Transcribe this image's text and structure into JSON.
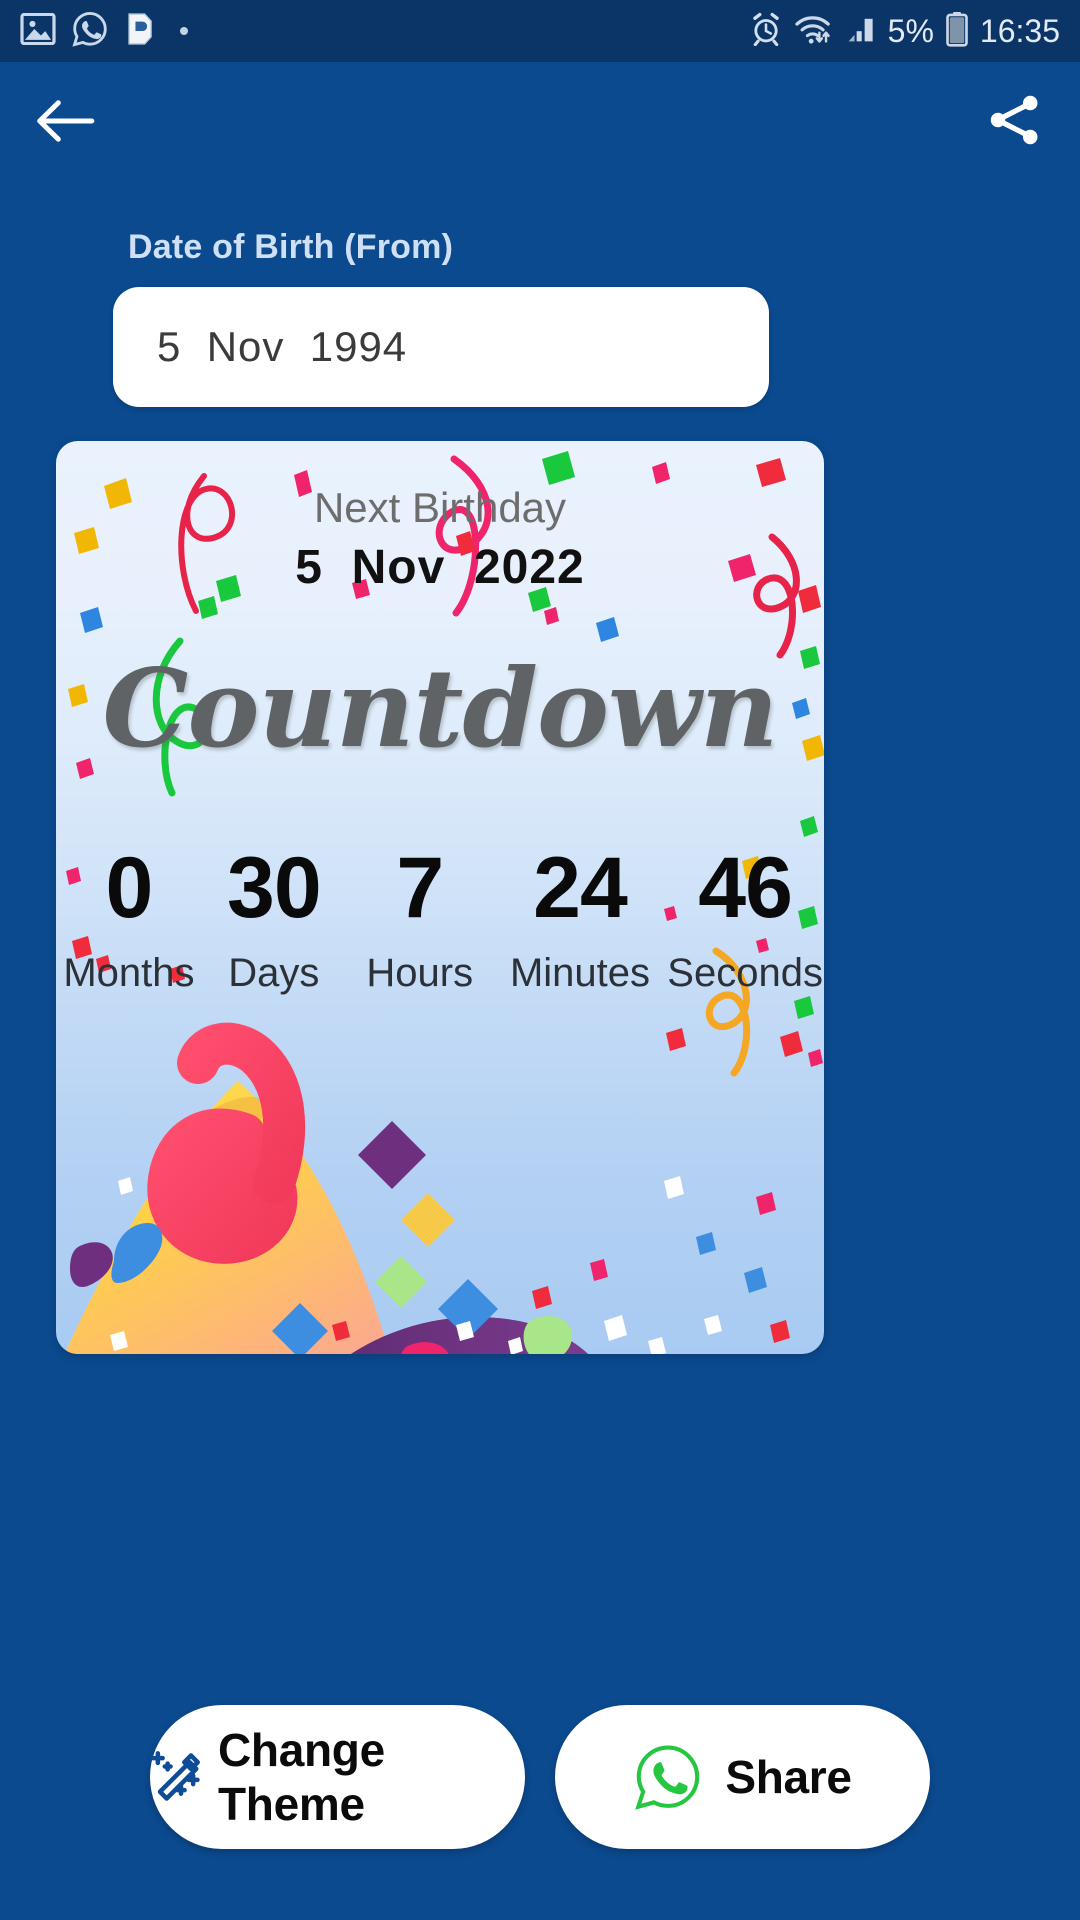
{
  "statusbar": {
    "left_icons": [
      "gallery-image-icon",
      "whatsapp-icon",
      "app-p-icon",
      "dot-indicator"
    ],
    "right_icons": [
      "alarm-clock-icon",
      "wifi-icon",
      "signal-bars-icon",
      "battery-icon"
    ],
    "battery_percent": "5%",
    "time": "16:35"
  },
  "topnav": {
    "back_icon": "back-arrow-icon",
    "share_icon": "share-icon"
  },
  "form": {
    "dob_label": "Date of Birth (From)",
    "dob_value": "5  Nov  1994"
  },
  "card": {
    "next_birthday_label": "Next Birthday",
    "next_birthday_date": "5  Nov  2022",
    "title": "Countdown",
    "units": [
      {
        "value": "0",
        "label": "Months"
      },
      {
        "value": "30",
        "label": "Days"
      },
      {
        "value": "7",
        "label": "Hours"
      },
      {
        "value": "24",
        "label": "Minutes"
      },
      {
        "value": "46",
        "label": "Seconds"
      }
    ]
  },
  "buttons": {
    "change_theme": {
      "label": "Change Theme",
      "icon": "magic-wand-icon"
    },
    "share": {
      "label": "Share",
      "icon": "whatsapp-icon"
    }
  },
  "colors": {
    "app_background": "#0b4a8f",
    "statusbar_background": "#0c3567",
    "card_top": "#e9f2fd",
    "card_bottom": "#a9cbf2",
    "whatsapp_green": "#25c640",
    "wand_blue": "#0f4c96"
  }
}
